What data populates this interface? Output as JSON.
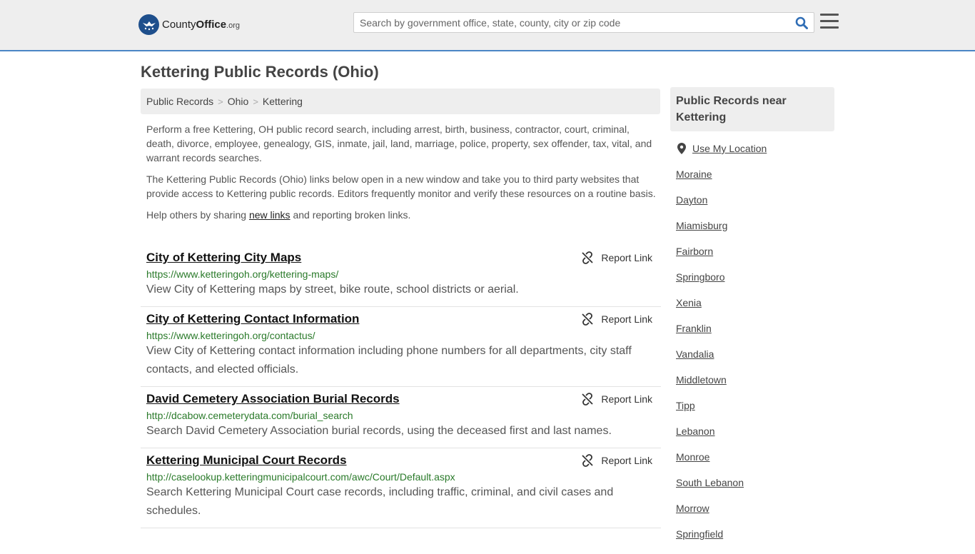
{
  "header": {
    "logo_main": "County",
    "logo_bold": "Office",
    "logo_suffix": ".org",
    "search_placeholder": "Search by government office, state, county, city or zip code"
  },
  "page_title": "Kettering Public Records (Ohio)",
  "breadcrumb": [
    "Public Records",
    "Ohio",
    "Kettering"
  ],
  "intro": {
    "p1": "Perform a free Kettering, OH public record search, including arrest, birth, business, contractor, court, criminal, death, divorce, employee, genealogy, GIS, inmate, jail, land, marriage, police, property, sex offender, tax, vital, and warrant records searches.",
    "p2": "The Kettering Public Records (Ohio) links below open in a new window and take you to third party websites that provide access to Kettering public records. Editors frequently monitor and verify these resources on a routine basis.",
    "p3_before": "Help others by sharing ",
    "p3_link": "new links",
    "p3_after": " and reporting broken links."
  },
  "report_label": "Report Link",
  "records": [
    {
      "title": "City of Kettering City Maps",
      "url": "https://www.ketteringoh.org/kettering-maps/",
      "desc": "View City of Kettering maps by street, bike route, school districts or aerial."
    },
    {
      "title": "City of Kettering Contact Information",
      "url": "https://www.ketteringoh.org/contactus/",
      "desc": "View City of Kettering contact information including phone numbers for all departments, city staff contacts, and elected officials."
    },
    {
      "title": "David Cemetery Association Burial Records",
      "url": "http://dcabow.cemeterydata.com/burial_search",
      "desc": "Search David Cemetery Association burial records, using the deceased first and last names."
    },
    {
      "title": "Kettering Municipal Court Records",
      "url": "http://caselookup.ketteringmunicipalcourt.com/awc/Court/Default.aspx",
      "desc": "Search Kettering Municipal Court case records, including traffic, criminal, and civil cases and schedules."
    }
  ],
  "sidebar": {
    "heading": "Public Records near Kettering",
    "use_location": "Use My Location",
    "nearby": [
      "Moraine",
      "Dayton",
      "Miamisburg",
      "Fairborn",
      "Springboro",
      "Xenia",
      "Franklin",
      "Vandalia",
      "Middletown",
      "Tipp",
      "Lebanon",
      "Monroe",
      "South Lebanon",
      "Morrow",
      "Springfield"
    ]
  },
  "colors": {
    "accent": "#4a86c5",
    "url_green": "#2a7a2a",
    "logo_blue": "#1e4f8c",
    "search_icon_blue": "#2f6db5"
  }
}
